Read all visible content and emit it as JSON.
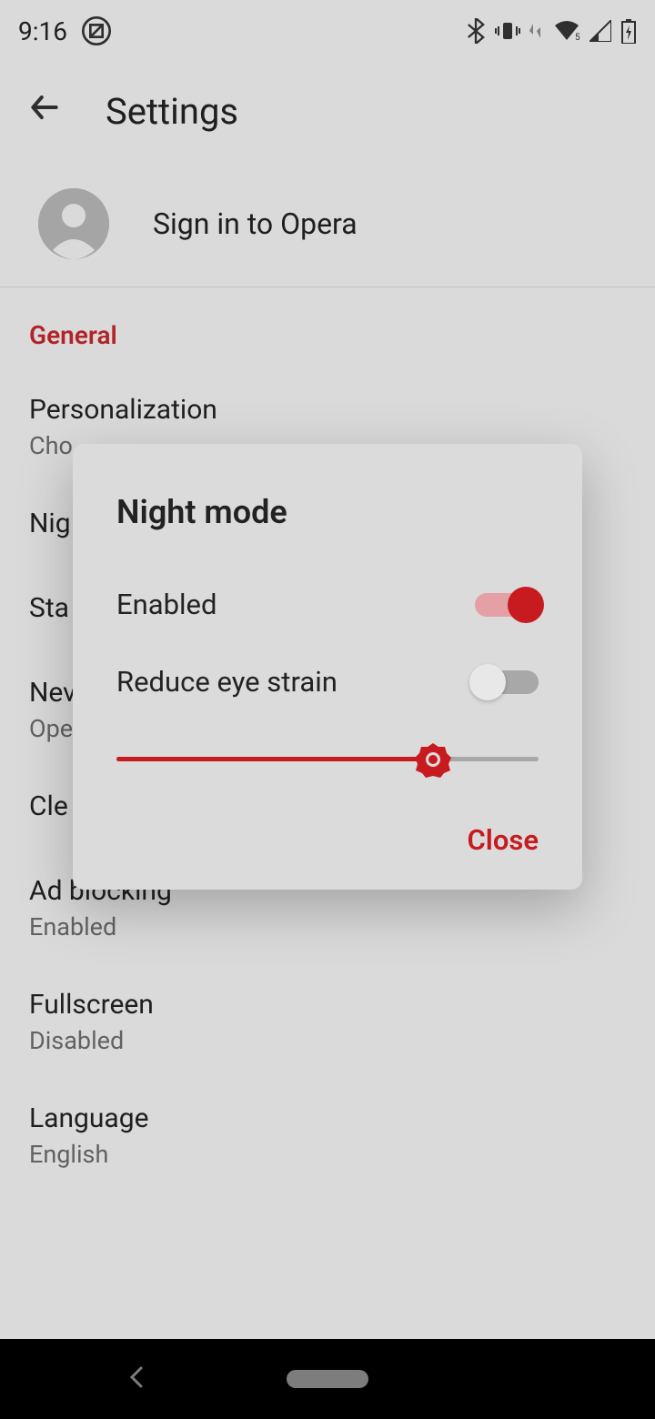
{
  "status": {
    "time": "9:16"
  },
  "header": {
    "title": "Settings"
  },
  "signin": {
    "label": "Sign in to Opera"
  },
  "section": {
    "general": "General"
  },
  "items": {
    "personalization": {
      "title": "Personalization",
      "sub": "Cho"
    },
    "night": {
      "title": "Nig"
    },
    "startup": {
      "title": "Sta"
    },
    "news": {
      "title": "Nev",
      "sub": "Ope"
    },
    "clear": {
      "title": "Cle"
    },
    "adblock": {
      "title": "Ad blocking",
      "sub": "Enabled"
    },
    "fullscreen": {
      "title": "Fullscreen",
      "sub": "Disabled"
    },
    "language": {
      "title": "Language",
      "sub": "English"
    }
  },
  "dialog": {
    "title": "Night mode",
    "enabled": {
      "label": "Enabled",
      "value": true
    },
    "reduce": {
      "label": "Reduce eye strain",
      "value": false
    },
    "slider_percent": 75,
    "close": "Close"
  },
  "colors": {
    "accent": "#c71b1f"
  }
}
